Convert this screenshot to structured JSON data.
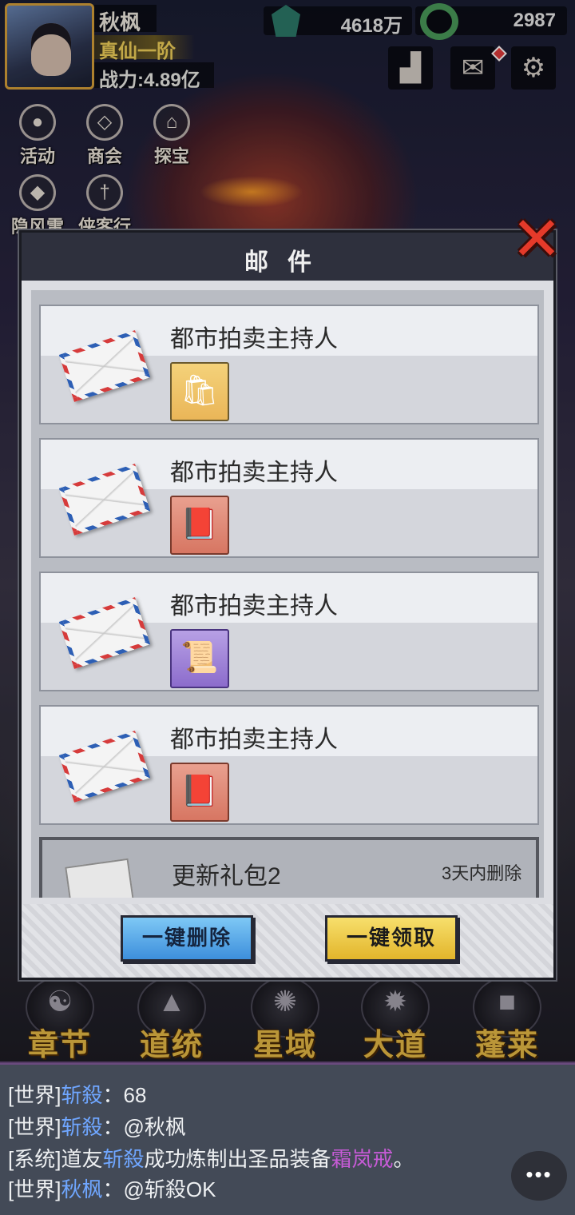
{
  "player": {
    "name": "秋枫",
    "rank": "真仙一阶",
    "power": "战力:4.89亿"
  },
  "resources": {
    "gems": "4618万",
    "jade": "2987"
  },
  "side_menu": [
    {
      "label": "活动",
      "icon": "balloons-icon"
    },
    {
      "label": "商会",
      "icon": "shop-icon"
    },
    {
      "label": "探宝",
      "icon": "pavilion-icon"
    },
    {
      "label": "隐风雷",
      "icon": "flame-icon"
    },
    {
      "label": "侠客行",
      "icon": "sword-icon"
    }
  ],
  "modal": {
    "title": "邮件",
    "mails": [
      {
        "sender": "都市拍卖主持人",
        "item_icon": "gift-bag-icon",
        "item_color": "gold"
      },
      {
        "sender": "都市拍卖主持人",
        "item_icon": "red-book-icon",
        "item_color": "red"
      },
      {
        "sender": "都市拍卖主持人",
        "item_icon": "scroll-icon",
        "item_color": "purple"
      },
      {
        "sender": "都市拍卖主持人",
        "item_icon": "red-book-icon",
        "item_color": "red"
      }
    ],
    "read_mail": {
      "title": "更新礼包2",
      "expire": "3天内删除"
    },
    "delete_all": "一键删除",
    "claim_all": "一键领取"
  },
  "bottom_nav": [
    {
      "label": "章节"
    },
    {
      "label": "道统"
    },
    {
      "label": "星域"
    },
    {
      "label": "大道"
    },
    {
      "label": "蓬莱"
    }
  ],
  "chat": [
    {
      "channel": "[世界]",
      "name": "斩殺",
      "sep": "：",
      "text": "68"
    },
    {
      "channel": "[世界]",
      "name": "斩殺",
      "sep": "：",
      "text": "@秋枫"
    },
    {
      "channel": "[系统]",
      "pre": "道友",
      "name": "斩殺",
      "mid": "成功炼制出圣品装备",
      "item": "霜岚戒",
      "end": "。"
    },
    {
      "channel": "[世界]",
      "name": "秋枫",
      "sep": "：",
      "text": "@斩殺OK"
    }
  ],
  "colors": {
    "accent_gold": "#e9bc46",
    "chat_name": "#6fa6ff",
    "chat_item": "#c65bd6",
    "close_red": "#e53a2a"
  }
}
